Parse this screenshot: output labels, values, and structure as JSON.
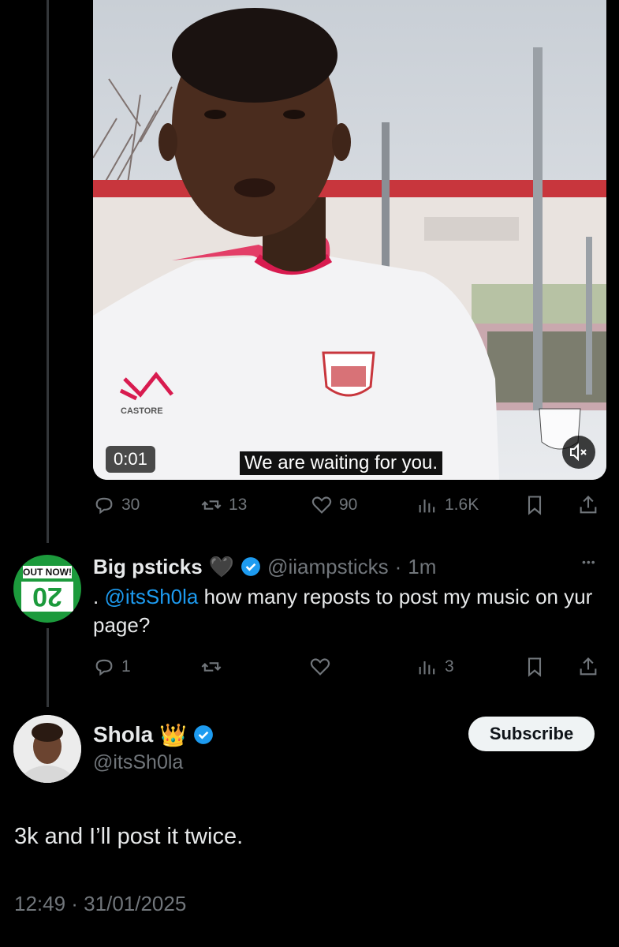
{
  "video": {
    "timestamp": "0:01",
    "caption": "We are waiting for you.",
    "jersey_brand": "CASTORE"
  },
  "tweet_actions": {
    "replies": "30",
    "reposts": "13",
    "likes": "90",
    "views": "1.6K"
  },
  "reply": {
    "avatar_badge": "OUT NOW!",
    "avatar_text": "20",
    "display_name": "Big psticks",
    "name_emoji": "🖤",
    "handle": "@iiampsticks",
    "separator": "·",
    "time": "1m",
    "more": "•••",
    "text_prefix": ".",
    "mention": "@itsSh0la",
    "text": " how many reposts to post my music on yur page?",
    "actions": {
      "replies": "1",
      "reposts": "",
      "likes": "",
      "views": "3"
    }
  },
  "main": {
    "display_name": "Shola",
    "name_emoji": "👑",
    "handle": "@itsSh0la",
    "subscribe_label": "Subscribe",
    "text": "3k and I’ll post it twice.",
    "timestamp": "12:49 · 31/01/2025"
  },
  "colors": {
    "accent": "#1d9bf0",
    "muted": "#71767b",
    "background": "#000000"
  }
}
